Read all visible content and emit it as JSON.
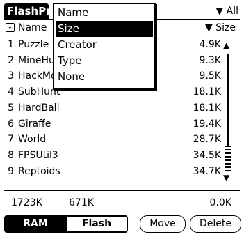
{
  "title": "FlashPro",
  "filter": {
    "arrow": "▼",
    "label": "All"
  },
  "header": {
    "name_label": "Name",
    "size_label": "Size",
    "sort_arrow": "▼"
  },
  "rows": [
    {
      "idx": "1",
      "name": "Puzzle",
      "size": "4.9K"
    },
    {
      "idx": "2",
      "name": "MineHu",
      "size": "9.3K"
    },
    {
      "idx": "3",
      "name": "HackMo",
      "size": "9.5K"
    },
    {
      "idx": "4",
      "name": "SubHunt",
      "size": "18.1K"
    },
    {
      "idx": "5",
      "name": "HardBall",
      "size": "18.1K"
    },
    {
      "idx": "6",
      "name": "Giraffe",
      "size": "19.4K"
    },
    {
      "idx": "7",
      "name": "World",
      "size": "28.7K"
    },
    {
      "idx": "8",
      "name": "FPSUtil3",
      "size": "34.5K"
    },
    {
      "idx": "9",
      "name": "Reptoids",
      "size": "34.7K"
    }
  ],
  "footer": {
    "total": "1723K",
    "free": "671K",
    "selected": "0.0K"
  },
  "segment": {
    "ram": "RAM",
    "flash": "Flash"
  },
  "buttons": {
    "move": "Move",
    "delete": "Delete"
  },
  "sort_menu": {
    "options": [
      "Name",
      "Size",
      "Creator",
      "Type",
      "None"
    ],
    "selected": "Size"
  }
}
